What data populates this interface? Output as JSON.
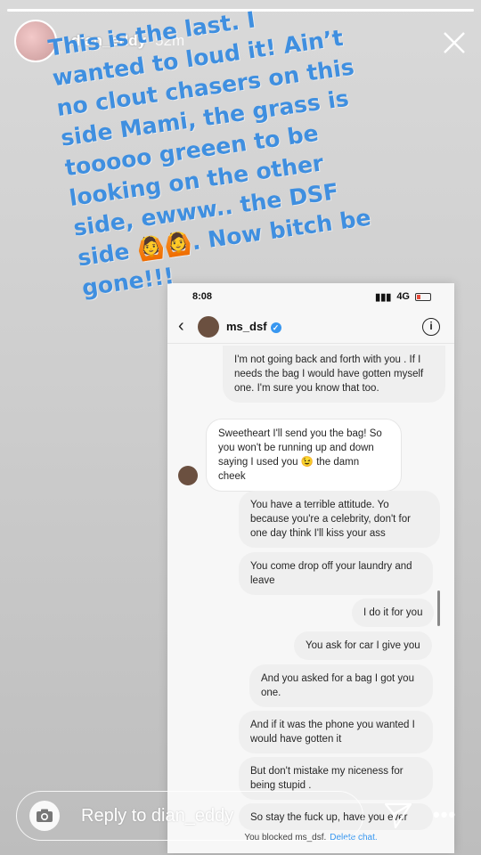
{
  "story": {
    "progress": 1.0,
    "username": "dian_eddy",
    "time": "52m",
    "caption": "This is the last. I wanted to loud it! Ain’t no clout chasers on this side Mami, the grass is tooooo greeen to be looking on the other side, ewww.. the DSF side 🙆🙆. Now bitch be gone!!!"
  },
  "screenshot": {
    "status_time": "8:08",
    "status_network": "4G",
    "chat_name": "ms_dsf",
    "messages": [
      {
        "dir": "out",
        "text": "I'm not going back and forth with you . If I needs the bag I would have gotten myself one. I'm sure you know that too."
      },
      {
        "dir": "in",
        "text": "Sweetheart I'll send you the bag! So you won't be running up and down saying I used you 😉 the damn cheek"
      },
      {
        "dir": "out",
        "text": "You have a terrible attitude. Yo because you're a celebrity, don't for one day think I'll kiss your ass"
      },
      {
        "dir": "out",
        "text": "You come drop off your laundry and leave"
      },
      {
        "dir": "out",
        "text": "I do it for you"
      },
      {
        "dir": "out",
        "text": "You ask for car I give you"
      },
      {
        "dir": "out",
        "text": "And you asked for a bag I got you one."
      },
      {
        "dir": "out",
        "text": "And if it was the phone you wanted I would have gotten it"
      },
      {
        "dir": "out",
        "text": "But don't mistake my niceness for being stupid ."
      },
      {
        "dir": "out",
        "text": "So stay the fuck up, have you ever"
      }
    ],
    "blocked_text": "You blocked ms_dsf.",
    "delete_label": "Delete chat."
  },
  "footer": {
    "reply_placeholder": "Reply to dian_eddy",
    "more_label": "•••"
  }
}
